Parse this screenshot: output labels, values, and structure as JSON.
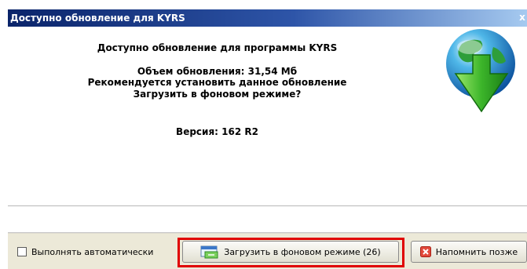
{
  "window": {
    "title": "Доступно обновление для KYRS",
    "close_label": "x"
  },
  "message": {
    "heading": "Доступно обновление для программы KYRS",
    "size_line": "Объем обновления: 31,54 Мб",
    "recommend_line": "Рекомендуется установить данное обновление",
    "question_line": "Загрузить в фоновом режиме?",
    "version_line": "Версия: 162  R2"
  },
  "footer": {
    "auto_checkbox_label": "Выполнять автоматически",
    "auto_checkbox_checked": false,
    "download_button_label": "Загрузить в фоновом режиме (26)",
    "remind_button_label": "Напомнить позже"
  },
  "icons": {
    "globe": "globe-download-icon",
    "download_button": "download-window-icon",
    "remind_button": "close-red-icon"
  },
  "colors": {
    "title_bar_start": "#0a246a",
    "title_bar_end": "#a6caf0",
    "highlight": "#e00000",
    "footer_bg": "#ece9d8"
  }
}
